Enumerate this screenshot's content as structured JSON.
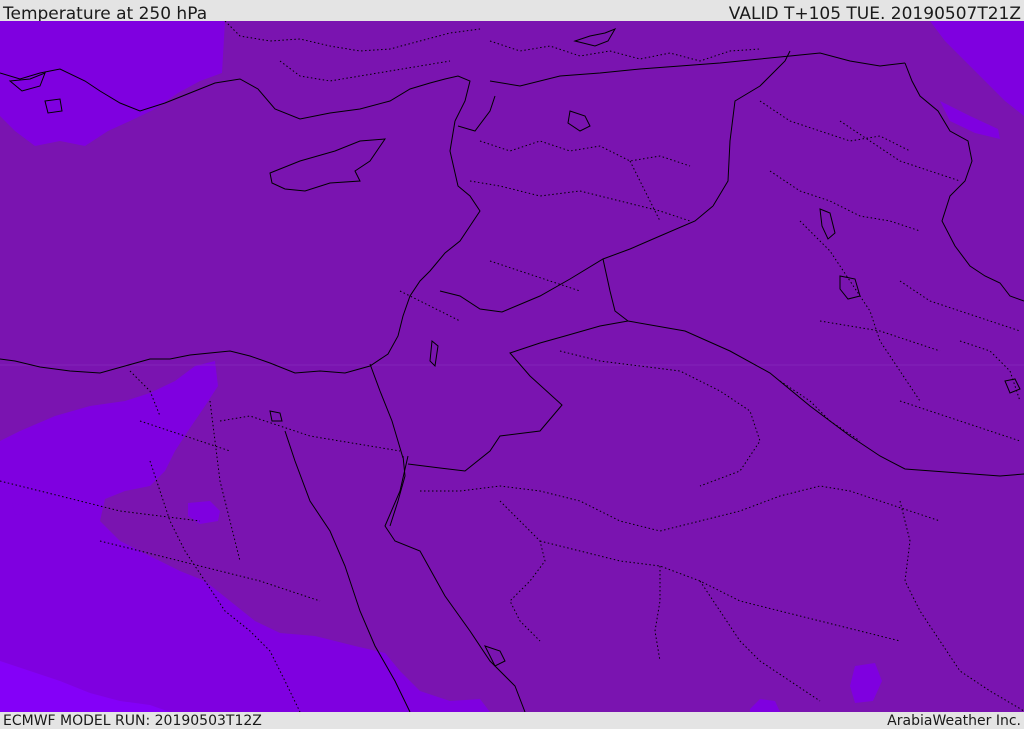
{
  "header": {
    "title": "Temperature at 250 hPa",
    "valid_time": "VALID T+105 TUE. 20190507T21Z"
  },
  "footer": {
    "model_run": "ECMWF MODEL RUN: 20190503T12Z",
    "credit": "ArabiaWeather Inc."
  },
  "map": {
    "colors": {
      "dominant_fill": "#7a14b0",
      "cool_fill": "#7f00e0",
      "cooler_fill": "#8400f8",
      "coastline": "#000000",
      "border": "#000000"
    }
  }
}
